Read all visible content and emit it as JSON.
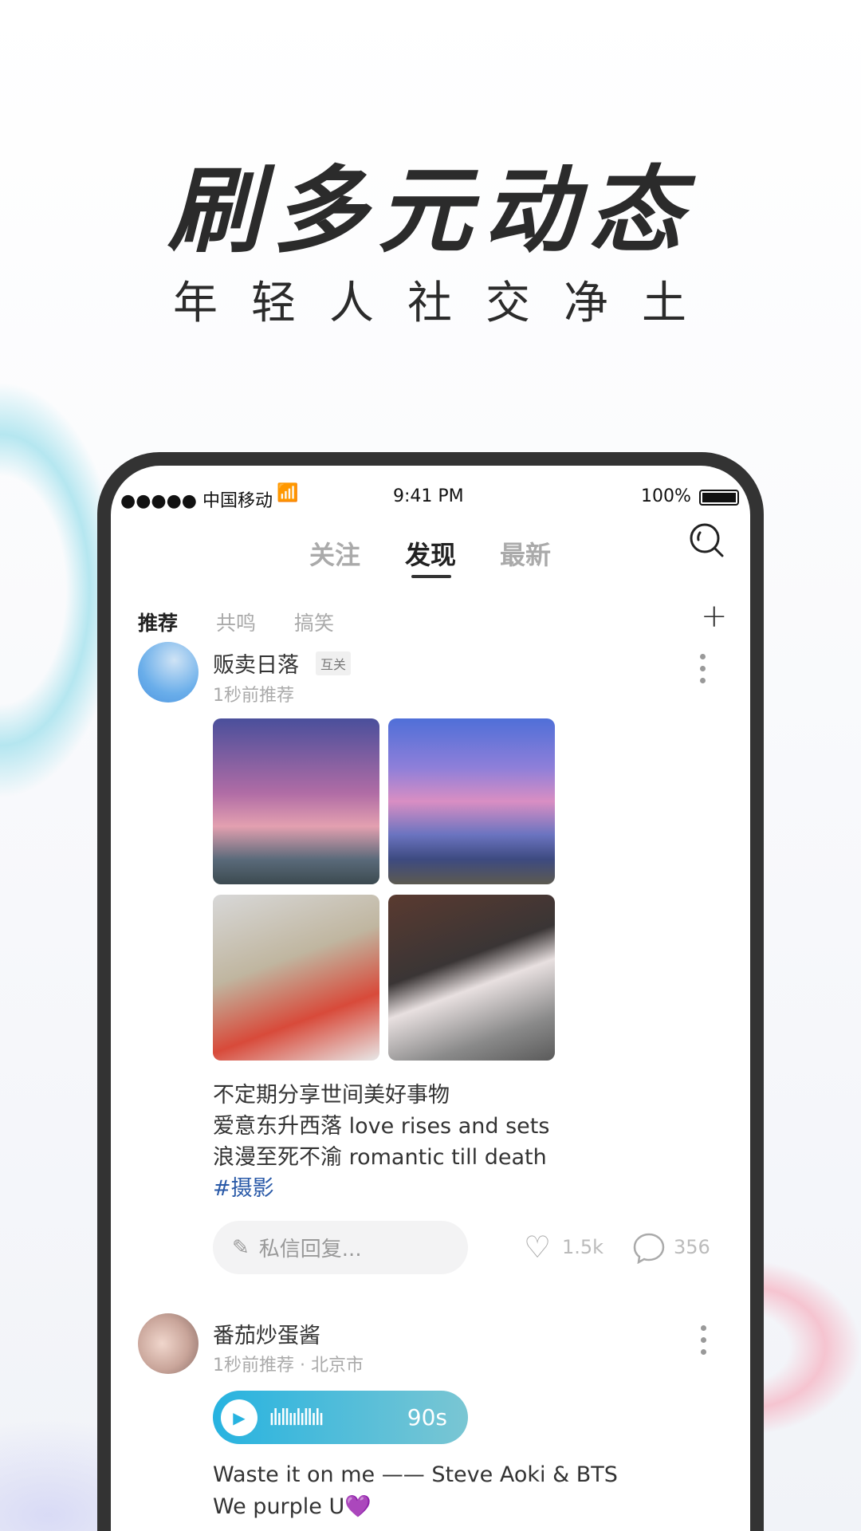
{
  "promo": {
    "title": "刷多元动态",
    "subtitle": "年轻人社交净土"
  },
  "status_bar": {
    "carrier": "●●●●● 中国移动",
    "time": "9:41 PM",
    "battery": "100%"
  },
  "tabs": [
    {
      "label": "关注"
    },
    {
      "label": "发现",
      "active": true
    },
    {
      "label": "最新"
    }
  ],
  "subtabs": [
    {
      "label": "推荐",
      "active": true
    },
    {
      "label": "共鸣"
    },
    {
      "label": "搞笑"
    }
  ],
  "posts": [
    {
      "author": "贩卖日落",
      "badge": "互关",
      "meta": "1秒前推荐",
      "lines": [
        "不定期分享世间美好事物",
        "爱意东升西落 love rises and sets",
        "浪漫至死不渝 romantic till death"
      ],
      "hashtag": "#摄影",
      "reply_placeholder": "私信回复...",
      "likes": "1.5k",
      "comments": "356"
    },
    {
      "author": "番茄炒蛋酱",
      "meta": "1秒前推荐 · 北京市",
      "audio_duration": "90s",
      "lines": [
        "Waste it on me —— Steve Aoki & BTS",
        "We purple U💜"
      ]
    }
  ],
  "colors": {
    "accent_hashtag": "#2a5aa8",
    "audio_start": "#27b3e0",
    "audio_end": "#7ac6d3"
  }
}
